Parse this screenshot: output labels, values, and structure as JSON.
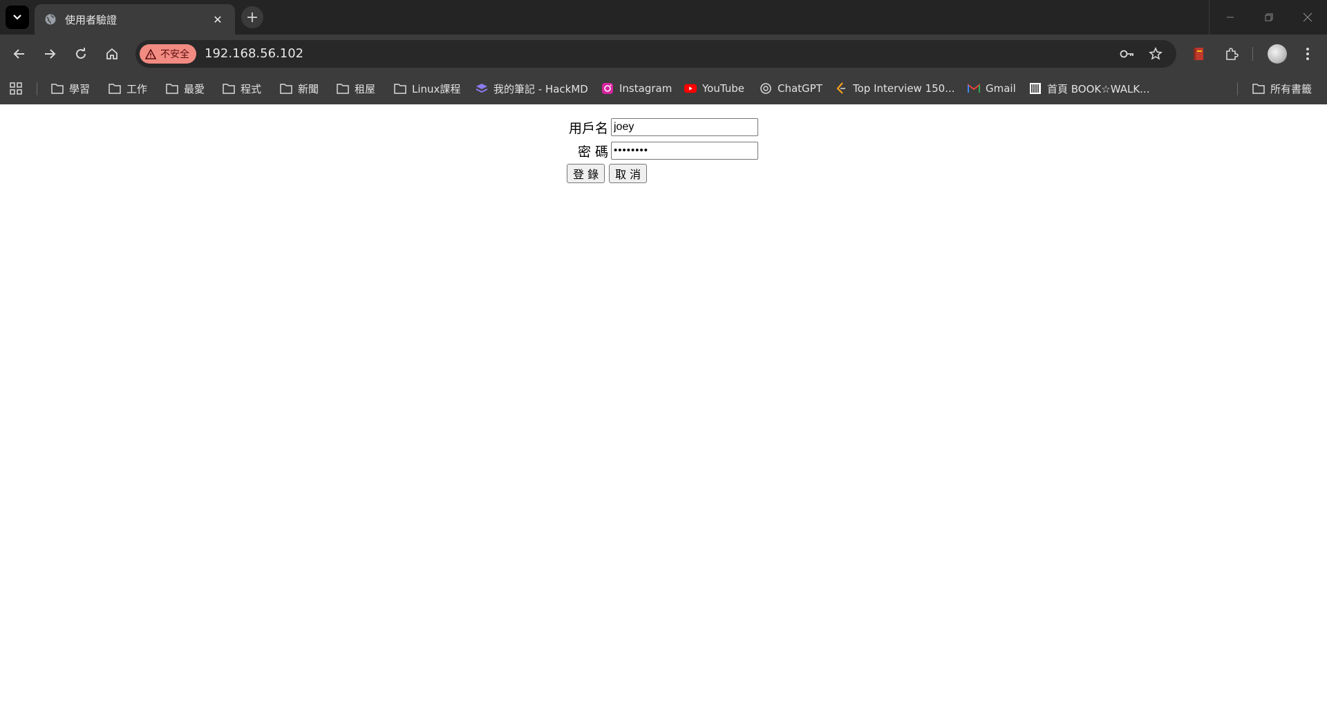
{
  "tab": {
    "title": "使用者驗證"
  },
  "toolbar": {
    "security_label": "不安全",
    "url": "192.168.56.102"
  },
  "bookmarks": [
    {
      "label": "學習",
      "icon": "folder-icon"
    },
    {
      "label": "工作",
      "icon": "folder-icon"
    },
    {
      "label": "最愛",
      "icon": "folder-icon"
    },
    {
      "label": "程式",
      "icon": "folder-icon"
    },
    {
      "label": "新聞",
      "icon": "folder-icon"
    },
    {
      "label": "租屋",
      "icon": "folder-icon"
    },
    {
      "label": "Linux課程",
      "icon": "folder-icon"
    },
    {
      "label": "我的筆記 - HackMD",
      "icon": "hackmd-icon"
    },
    {
      "label": "Instagram",
      "icon": "instagram-icon"
    },
    {
      "label": "YouTube",
      "icon": "youtube-icon"
    },
    {
      "label": "ChatGPT",
      "icon": "chatgpt-icon"
    },
    {
      "label": "Top Interview 150...",
      "icon": "leetcode-icon"
    },
    {
      "label": "Gmail",
      "icon": "gmail-icon"
    },
    {
      "label": "首頁 BOOK☆WALK...",
      "icon": "bookwalker-icon"
    },
    {
      "label": "所有書籤",
      "icon": "folder-icon"
    }
  ],
  "form": {
    "username_label": "用戶名",
    "username_value": "joey",
    "password_label": "密 碼",
    "password_value": "••••••••",
    "login_button": "登 錄",
    "cancel_button": "取 消"
  },
  "colors": {
    "security_chip": "#f28b82",
    "chrome_bg": "#3c3c3c",
    "tabstrip_bg": "#242424"
  }
}
